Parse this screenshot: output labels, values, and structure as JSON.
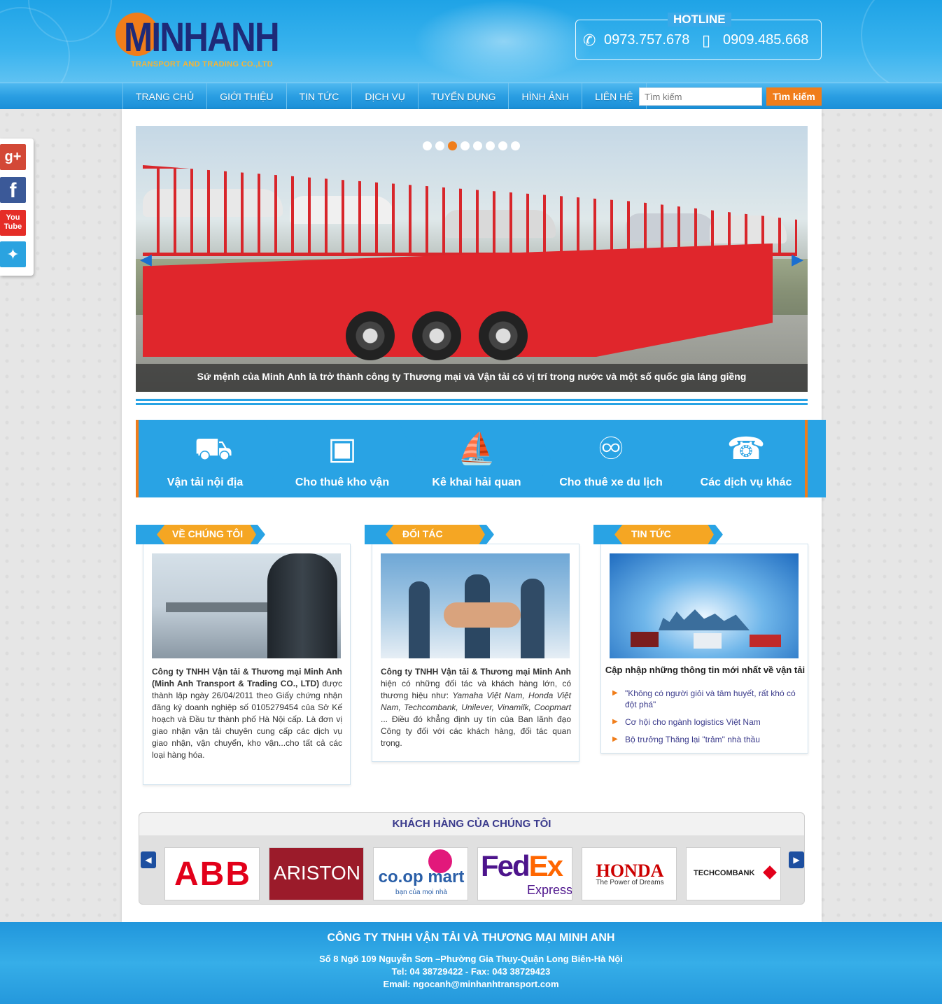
{
  "header": {
    "logo_brand": "MINHANH",
    "logo_tagline": "TRANSPORT AND TRADING CO.,LTD",
    "hotline_title": "HOTLINE",
    "phone_1": "0973.757.678",
    "phone_2": "0909.485.668"
  },
  "nav": {
    "items": [
      "TRANG CHỦ",
      "GIỚI THIỆU",
      "TIN TỨC",
      "DỊCH VỤ",
      "TUYỂN DỤNG",
      "HÌNH ẢNH",
      "LIÊN HỆ"
    ],
    "search_placeholder": "Tìm kiếm",
    "search_button": "Tìm kiếm"
  },
  "social": {
    "icons": [
      "google-plus-icon",
      "facebook-icon",
      "youtube-icon",
      "twitter-icon"
    ]
  },
  "slider": {
    "caption": "Sứ mệnh của Minh Anh là trở thành công ty Thương mại và Vận tải có vị trí trong nước và một số quốc gia láng giềng",
    "dot_count": 8,
    "active_dot": 3
  },
  "services": [
    {
      "label": "Vận tải nội địa",
      "icon": "truck-icon"
    },
    {
      "label": "Cho thuê kho vận",
      "icon": "forklift-icon"
    },
    {
      "label": "Kê khai hải quan",
      "icon": "ship-icon"
    },
    {
      "label": "Cho thuê xe du lịch",
      "icon": "car-icon"
    },
    {
      "label": "Các dịch vụ khác",
      "icon": "support-icon"
    }
  ],
  "about": {
    "title": "VỀ CHÚNG TÔI",
    "lead": "Công ty TNHH Vận tải & Thương mại Minh Anh (Minh Anh Transport & Trading CO., LTD)",
    "body": " được thành lập ngày 26/04/2011 theo Giấy chứng nhận đăng ký doanh nghiệp số 0105279454 của Sở Kế hoạch và Đầu tư thành phố Hà Nội cấp. Là đơn vị giao nhận vận tải chuyên cung cấp các dịch vụ giao nhận, vận chuyển, kho vận...cho tất cả các loại hàng hóa."
  },
  "partners": {
    "title": "ĐỐI TÁC",
    "lead": "Công ty TNHH Vận tải & Thương mại Minh Anh",
    "body_1": " hiện có những đối tác và khách hàng lớn, có thương hiệu như: ",
    "brands": "Yamaha Việt Nam, Honda Việt Nam, Techcombank, Unilever, Vinamilk, Coopmart",
    "body_2": " ... Điều đó khẳng định uy tín của Ban lãnh đạo Công ty đối với các khách hàng, đối tác quan trọng."
  },
  "news": {
    "title": "TIN TỨC",
    "headline": "Cập nhập những thông tin mới nhất về vận tải",
    "items": [
      "\"Không có người giỏi và tâm huyết, rất khó có đột phá\"",
      "Cơ hội cho ngành logistics Việt Nam",
      "Bộ trưởng Thăng lại \"trảm\" nhà thầu"
    ]
  },
  "customers": {
    "title": "KHÁCH HÀNG CỦA CHÚNG TÔI",
    "logos": [
      "ABB",
      "ARISTON",
      "co.op mart",
      "FedEx Express",
      "HONDA",
      "TECHCOMBANK"
    ],
    "coop_tagline": "bạn của mọi nhà",
    "honda_tagline": "The Power of Dreams",
    "fedex_sub": "Express"
  },
  "footer": {
    "company": "CÔNG TY TNHH VẬN TẢI VÀ THƯƠNG MẠI MINH ANH",
    "address": "Số 8 Ngõ 109 Nguyễn Sơn –Phường Gia Thụy-Quận Long Biên-Hà Nội",
    "phone": "Tel: 04 38729422 - Fax: 043 38729423",
    "email": "Email: ngocanh@minhanhtransport.com"
  },
  "colors": {
    "primary": "#29a3e4",
    "accent": "#f07d1a",
    "dark_blue": "#1e2a78"
  }
}
